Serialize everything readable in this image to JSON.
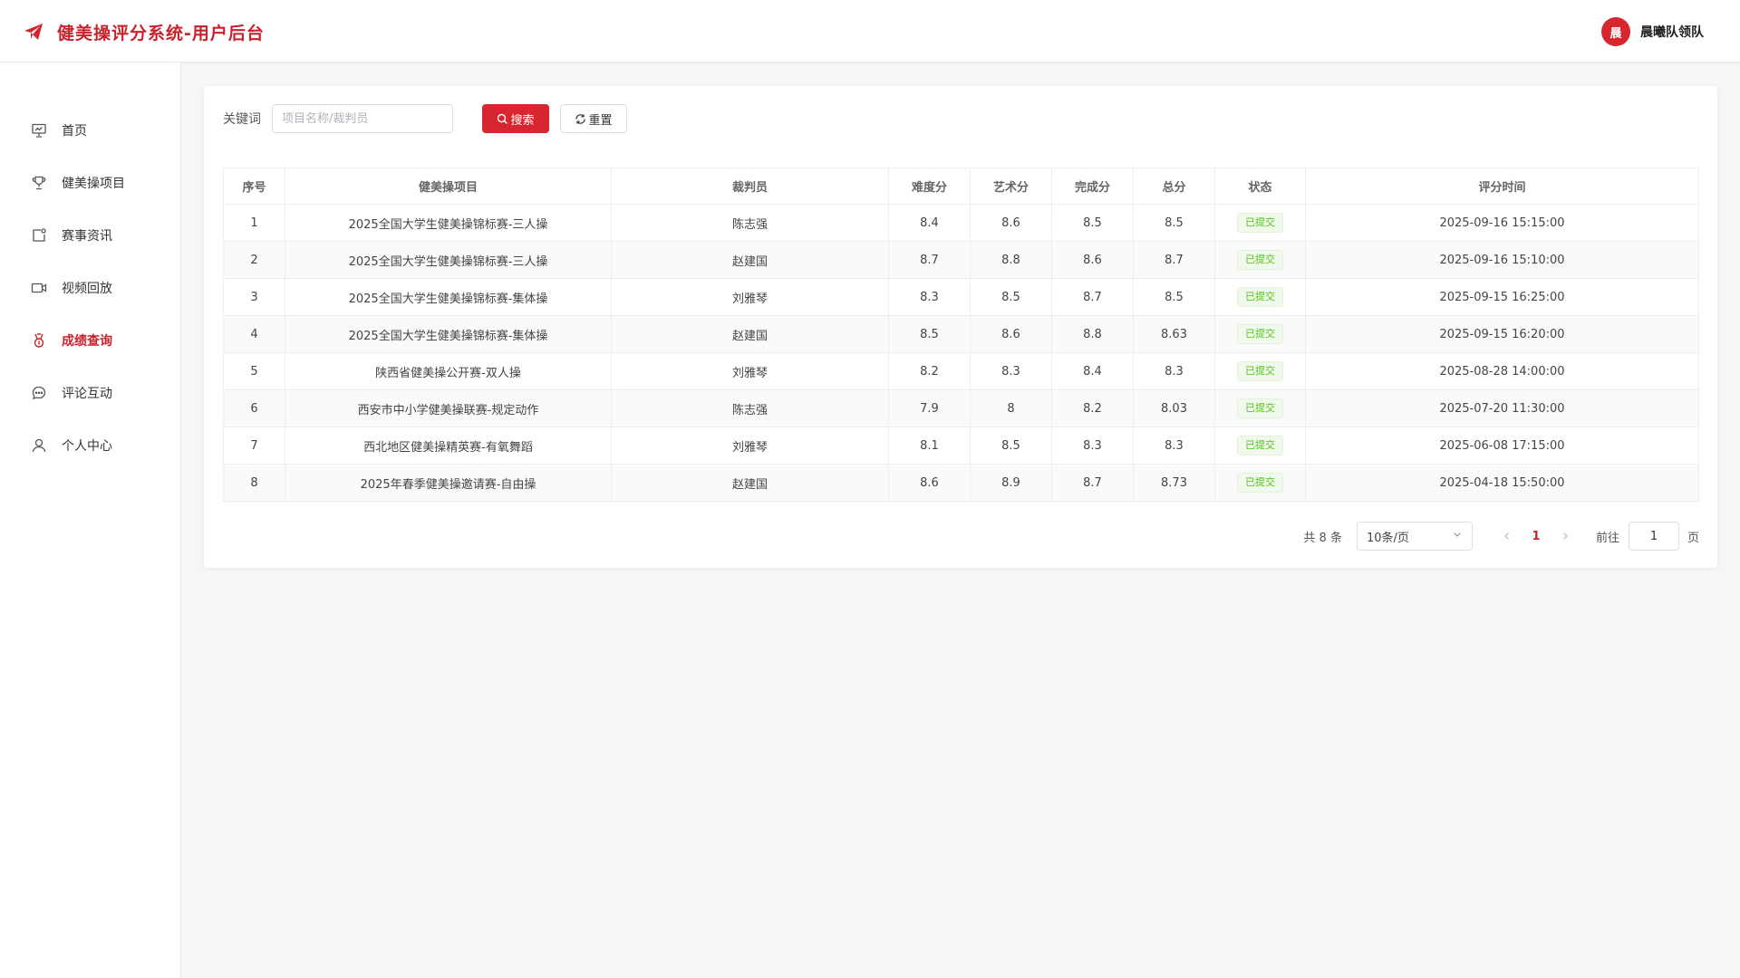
{
  "header": {
    "title": "健美操评分系统-用户后台",
    "user_avatar_text": "晨",
    "user_name": "晨曦队领队",
    "accent_color": "#c8232c"
  },
  "sidebar": {
    "items": [
      {
        "label": "首页",
        "icon": "presentation-icon",
        "active": false
      },
      {
        "label": "健美操项目",
        "icon": "trophy-icon",
        "active": false
      },
      {
        "label": "赛事资讯",
        "icon": "news-icon",
        "active": false
      },
      {
        "label": "视频回放",
        "icon": "video-camera-icon",
        "active": false
      },
      {
        "label": "成绩查询",
        "icon": "medal-icon",
        "active": true
      },
      {
        "label": "评论互动",
        "icon": "chat-icon",
        "active": false
      },
      {
        "label": "个人中心",
        "icon": "user-icon",
        "active": false
      }
    ]
  },
  "filter": {
    "label": "关键词",
    "placeholder": "项目名称/裁判员",
    "value": "",
    "search_label": "搜索",
    "reset_label": "重置"
  },
  "table": {
    "columns": [
      "序号",
      "健美操项目",
      "裁判员",
      "难度分",
      "艺术分",
      "完成分",
      "总分",
      "状态",
      "评分时间"
    ],
    "rows": [
      [
        "1",
        "2025全国大学生健美操锦标赛-三人操",
        "陈志强",
        "8.4",
        "8.6",
        "8.5",
        "8.5",
        "已提交",
        "2025-09-16 15:15:00"
      ],
      [
        "2",
        "2025全国大学生健美操锦标赛-三人操",
        "赵建国",
        "8.7",
        "8.8",
        "8.6",
        "8.7",
        "已提交",
        "2025-09-16 15:10:00"
      ],
      [
        "3",
        "2025全国大学生健美操锦标赛-集体操",
        "刘雅琴",
        "8.3",
        "8.5",
        "8.7",
        "8.5",
        "已提交",
        "2025-09-15 16:25:00"
      ],
      [
        "4",
        "2025全国大学生健美操锦标赛-集体操",
        "赵建国",
        "8.5",
        "8.6",
        "8.8",
        "8.63",
        "已提交",
        "2025-09-15 16:20:00"
      ],
      [
        "5",
        "陕西省健美操公开赛-双人操",
        "刘雅琴",
        "8.2",
        "8.3",
        "8.4",
        "8.3",
        "已提交",
        "2025-08-28 14:00:00"
      ],
      [
        "6",
        "西安市中小学健美操联赛-规定动作",
        "陈志强",
        "7.9",
        "8",
        "8.2",
        "8.03",
        "已提交",
        "2025-07-20 11:30:00"
      ],
      [
        "7",
        "西北地区健美操精英赛-有氧舞蹈",
        "刘雅琴",
        "8.1",
        "8.5",
        "8.3",
        "8.3",
        "已提交",
        "2025-06-08 17:15:00"
      ],
      [
        "8",
        "2025年春季健美操邀请赛-自由操",
        "赵建国",
        "8.6",
        "8.9",
        "8.7",
        "8.73",
        "已提交",
        "2025-04-18 15:50:00"
      ]
    ]
  },
  "pagination": {
    "total_text": "共 8 条",
    "page_size": "10条/页",
    "current_page": "1",
    "goto_label": "前往",
    "goto_value": "1",
    "goto_unit": "页"
  }
}
